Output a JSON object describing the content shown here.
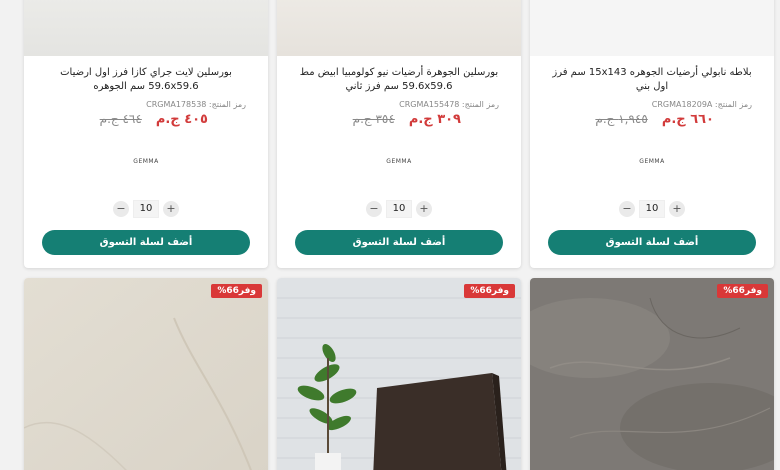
{
  "products": [
    {
      "title": "بلاطه نابولي أرضيات الجوهره 15x143 سم فرز اول بني",
      "code_label": "رمز المنتج:",
      "code": "CRGMA18209A",
      "price_new": "٦٦٠ ج.م",
      "price_old": "١,٩٤٥ ج.م",
      "brand": "GEMMA",
      "quantity": "10",
      "add_to_cart": "أضف لسلة التسوق",
      "thumb_color": "#f4f4f4"
    },
    {
      "title": "بورسلين الجوهرة أرضيات نيو كولومبيا ابيض مط 59.6x59.6 سم فرز ثاني",
      "code_label": "رمز المنتج:",
      "code": "CRGMA155478",
      "price_new": "٣٠٩ ج.م",
      "price_old": "٣٥٤ ج.م",
      "brand": "GEMMA",
      "quantity": "10",
      "add_to_cart": "أضف لسلة التسوق",
      "thumb_color": "#ece8e2"
    },
    {
      "title": "بورسلين لايت جراي كازا فرز اول ارضيات 59.6x59.6 سم الجوهره",
      "code_label": "رمز المنتج:",
      "code": "CRGMA178538",
      "price_new": "٤٠٥ ج.م",
      "price_old": "٤٦٤ ج.م",
      "brand": "GEMMA",
      "quantity": "10",
      "add_to_cart": "أضف لسلة التسوق",
      "thumb_color": "#e9e9e7"
    }
  ],
  "bottom_badges": [
    "وفر66%",
    "وفر66%",
    "وفر66%"
  ],
  "colors": {
    "accent": "#157f74",
    "discount": "#d93838",
    "price": "#d23b3b"
  }
}
